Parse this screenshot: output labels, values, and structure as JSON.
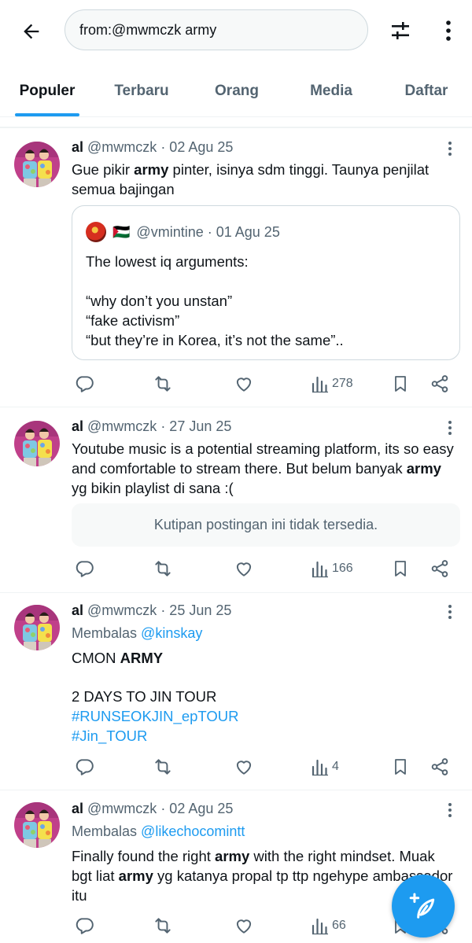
{
  "search": {
    "query": "from:@mwmczk army"
  },
  "tabs": [
    {
      "label": "Populer",
      "active": true
    },
    {
      "label": "Terbaru"
    },
    {
      "label": "Orang"
    },
    {
      "label": "Media"
    },
    {
      "label": "Daftar"
    }
  ],
  "tweets": [
    {
      "name": "al",
      "handle": "@mwmczk",
      "date": "· 02 Agu 25",
      "text_parts": [
        "Gue pikir ",
        "army",
        " pinter, isinya sdm tinggi. Taunya penjilat semua bajingan"
      ],
      "quote": {
        "flag": "🇵🇸",
        "handle": "@vmintine",
        "date": "· 01 Agu 25",
        "lines": [
          "The lowest iq arguments:",
          "",
          "“why don’t you unstan”",
          "“fake activism”",
          "“but they’re in Korea, it’s not the same”.."
        ]
      },
      "views": "278"
    },
    {
      "name": "al",
      "handle": "@mwmczk",
      "date": "· 27 Jun 25",
      "text_parts": [
        "Youtube music is a potential streaming platform, its so easy and comfortable to stream there. But belum banyak ",
        "army",
        " yg bikin playlist di sana :("
      ],
      "unavailable": "Kutipan postingan ini tidak tersedia.",
      "views": "166"
    },
    {
      "name": "al",
      "handle": "@mwmczk",
      "date": "· 25 Jun 25",
      "reply_label": "Membalas",
      "reply_to": "@kinskay",
      "text_parts": [
        "CMON ",
        "ARMY"
      ],
      "line2": "2 DAYS TO JIN TOUR",
      "hashtags": [
        "#RUNSEOKJIN_epTOUR",
        "#Jin_TOUR"
      ],
      "views": "4"
    },
    {
      "name": "al",
      "handle": "@mwmczk",
      "date": "· 02 Agu 25",
      "reply_label": "Membalas",
      "reply_to": "@likechocomintt",
      "text_parts": [
        "Finally found the right ",
        "army",
        " with the right mindset. Muak bgt liat ",
        "army",
        " yg katanya propal tp ttp ngehype ambassador itu"
      ],
      "views": "66"
    }
  ]
}
